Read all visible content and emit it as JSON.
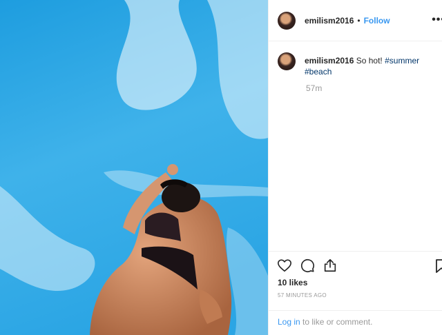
{
  "post": {
    "image_alt": "Woman in bikini against bright blue sky with clouds",
    "author": "emilism2016",
    "separator": "•",
    "follow_label": "Follow",
    "more_label": "•••"
  },
  "caption": {
    "username": "emilism2016",
    "text": "So hot!",
    "hashtags": [
      "#summer",
      "#beach"
    ],
    "time_ago": "57m"
  },
  "engagement": {
    "likes": "10 likes",
    "posted": "57 MINUTES AGO",
    "login_link": "Log in",
    "login_suffix": "to like or comment."
  },
  "icons": {
    "like": "heart-icon",
    "comment": "comment-icon",
    "share": "share-icon",
    "save": "bookmark-icon"
  },
  "colors": {
    "link": "#3897f0",
    "hashtag": "#003569",
    "muted": "#999999",
    "sky": "#2fa3e0"
  }
}
